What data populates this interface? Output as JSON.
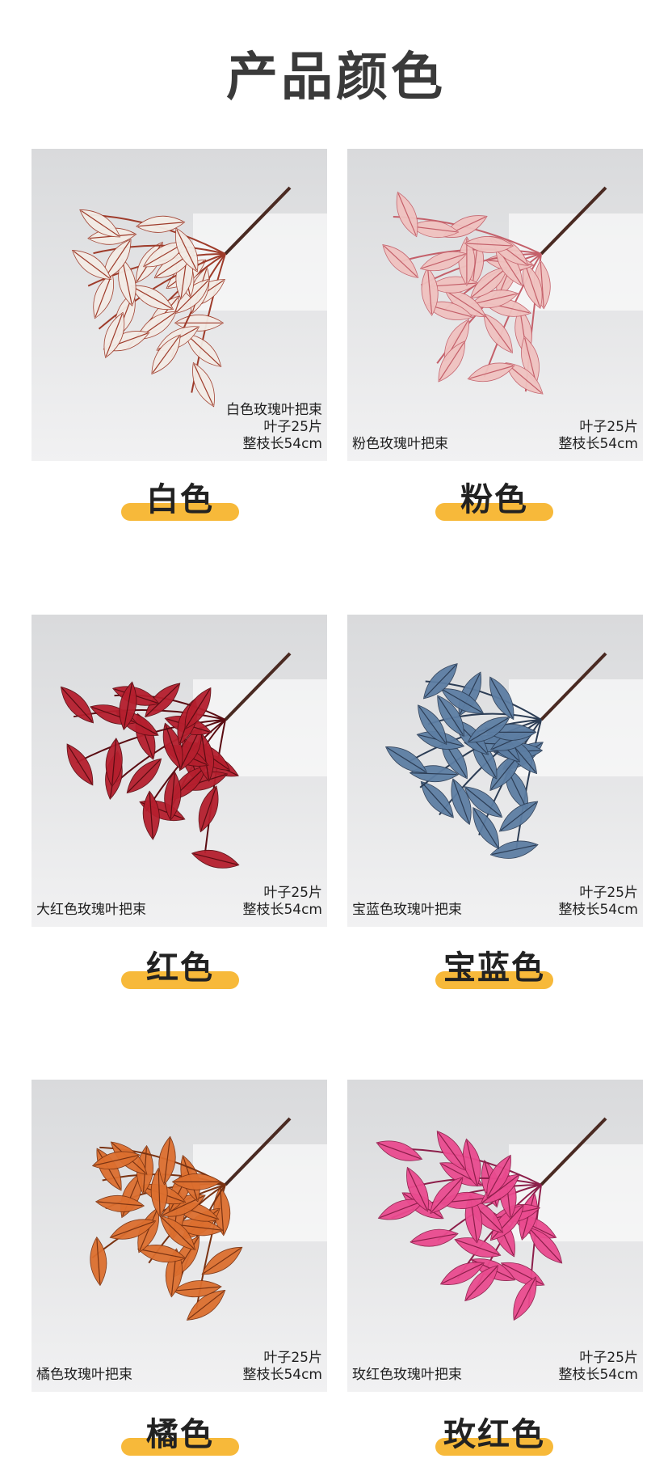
{
  "page_title": "产品颜色",
  "accent_color": "#f7b93a",
  "products": [
    {
      "label": "白色",
      "name": "白色玫瑰叶把束",
      "leaves": "叶子25片",
      "length": "整枝长54cm",
      "leaf_color": "#f3ece6",
      "vein_color": "#9e3b2a"
    },
    {
      "label": "粉色",
      "name": "粉色玫瑰叶把束",
      "leaves": "叶子25片",
      "length": "整枝长54cm",
      "leaf_color": "#f0c2c0",
      "vein_color": "#c4606a"
    },
    {
      "label": "红色",
      "name": "大红色玫瑰叶把束",
      "leaves": "叶子25片",
      "length": "整枝长54cm",
      "leaf_color": "#b51f2e",
      "vein_color": "#5a0c12"
    },
    {
      "label": "宝蓝色",
      "name": "宝蓝色玫瑰叶把束",
      "leaves": "叶子25片",
      "length": "整枝长54cm",
      "leaf_color": "#5d7ea3",
      "vein_color": "#2c3d55"
    },
    {
      "label": "橘色",
      "name": "橘色玫瑰叶把束",
      "leaves": "叶子25片",
      "length": "整枝长54cm",
      "leaf_color": "#dc6f2f",
      "vein_color": "#7a3312"
    },
    {
      "label": "玫红色",
      "name": "玫红色玫瑰叶把束",
      "leaves": "叶子25片",
      "length": "整枝长54cm",
      "leaf_color": "#ea4b8f",
      "vein_color": "#8c1e4a"
    }
  ]
}
